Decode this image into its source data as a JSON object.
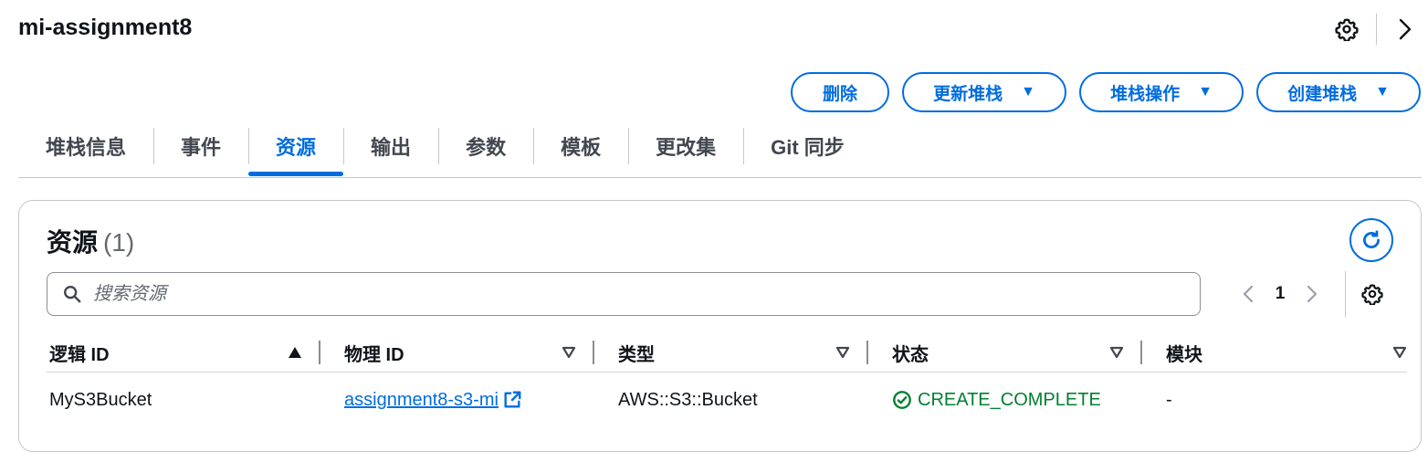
{
  "header": {
    "title": "mi-assignment8"
  },
  "icons": {
    "settings": "gear-icon",
    "next": "chevron-right-icon",
    "search": "search-icon",
    "refresh": "refresh-icon",
    "external": "external-link-icon",
    "status_ok": "check-circle-icon",
    "sort_asc": "sort-ascending-icon",
    "sort_desc": "sort-descending-icon"
  },
  "actions": {
    "delete": "删除",
    "update": "更新堆栈",
    "stack_actions": "堆栈操作",
    "create": "创建堆栈"
  },
  "tabs": [
    {
      "label": "堆栈信息"
    },
    {
      "label": "事件"
    },
    {
      "label": "资源",
      "active": true
    },
    {
      "label": "输出"
    },
    {
      "label": "参数"
    },
    {
      "label": "模板"
    },
    {
      "label": "更改集"
    },
    {
      "label": "Git 同步"
    }
  ],
  "resources": {
    "title": "资源",
    "count": "(1)",
    "search_placeholder": "搜索资源",
    "page": "1",
    "columns": {
      "logical_id": "逻辑 ID",
      "physical_id": "物理 ID",
      "type": "类型",
      "status": "状态",
      "module": "模块"
    },
    "rows": [
      {
        "logical_id": "MyS3Bucket",
        "physical_id": "assignment8-s3-mi",
        "type": "AWS::S3::Bucket",
        "status": "CREATE_COMPLETE",
        "module": "-"
      }
    ]
  },
  "colors": {
    "accent": "#006ce0",
    "success": "#00802f",
    "border": "#c6c6cd",
    "text": "#0f141a"
  }
}
